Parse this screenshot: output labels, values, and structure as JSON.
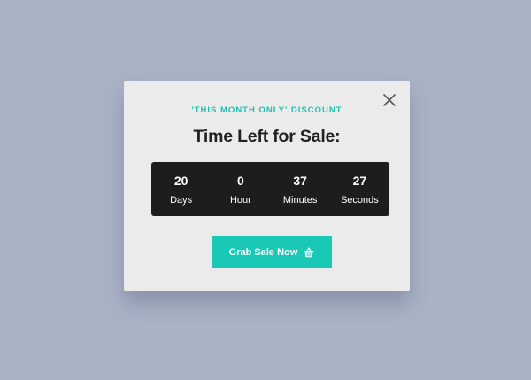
{
  "popup": {
    "eyebrow": "'THIS MONTH ONLY' DISCOUNT",
    "heading": "Time Left for Sale:",
    "countdown": [
      {
        "value": "20",
        "label": "Days"
      },
      {
        "value": "0",
        "label": "Hour"
      },
      {
        "value": "37",
        "label": "Minutes"
      },
      {
        "value": "27",
        "label": "Seconds"
      }
    ],
    "cta_label": "Grab Sale Now",
    "cta_icon": "basket-icon",
    "close_icon": "close-icon"
  },
  "colors": {
    "background": "#aab2c6",
    "card": "#ebebeb",
    "accent": "#19c9b6",
    "timer_bg": "#1d1d1d"
  }
}
